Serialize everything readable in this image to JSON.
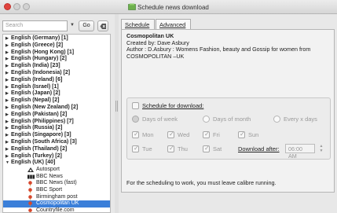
{
  "window": {
    "title": "Schedule news download"
  },
  "search": {
    "placeholder": "Search",
    "go_label": "Go"
  },
  "tree": {
    "languages": [
      "English (Germany) [1]",
      "English (Greece) [2]",
      "English (Hong Kong) [1]",
      "English (Hungary) [2]",
      "English (India) [23]",
      "English (Indonesia) [2]",
      "English (Ireland) [6]",
      "English (Israel) [1]",
      "English (Japan) [2]",
      "English (Nepal) [2]",
      "English (New Zealand) [2]",
      "English (Pakistan) [2]",
      "English (Philippines) [7]",
      "English (Russia) [2]",
      "English (Singapore) [3]",
      "English (South Africa) [3]",
      "English (Thailand) [2]",
      "English (Turkey) [2]",
      "English (UK) [40]"
    ],
    "children": [
      {
        "label": "Autosport",
        "icon": "autosport-icon"
      },
      {
        "label": "BBC News",
        "icon": "bbc-icon"
      },
      {
        "label": "BBC News (fast)",
        "icon": "pin-icon"
      },
      {
        "label": "BBC Sport",
        "icon": "pin-icon"
      },
      {
        "label": "Birmingham post",
        "icon": "pin-icon"
      },
      {
        "label": "Cosmopolitan UK",
        "icon": "pin-icon",
        "selected": true
      },
      {
        "label": "Countryfile.com",
        "icon": "pin-icon"
      }
    ]
  },
  "tabs": {
    "schedule": "Schedule",
    "advanced": "Advanced"
  },
  "info": {
    "title": "Cosmopolitan UK",
    "created": "Created by: Dave Asbury",
    "author_line1": "Author : D.Asbury : Womens Fashion, beauty and Gossip for women from",
    "author_line2": "COSMOPOLITAN –UK"
  },
  "schedule": {
    "enable_label": "Schedule for download:",
    "modes": [
      "Days of week",
      "Days of month",
      "Every x days"
    ],
    "days": [
      "Mon",
      "Wed",
      "Fri",
      "Sun",
      "Tue",
      "Thu",
      "Sat"
    ],
    "download_after_label": "Download after:",
    "download_after_value": "06:00 AM"
  },
  "footer": {
    "note": "For the scheduling to work, you must leave calibre running."
  },
  "colors": {
    "selection": "#3b7fd9",
    "close": "#e0443e"
  }
}
